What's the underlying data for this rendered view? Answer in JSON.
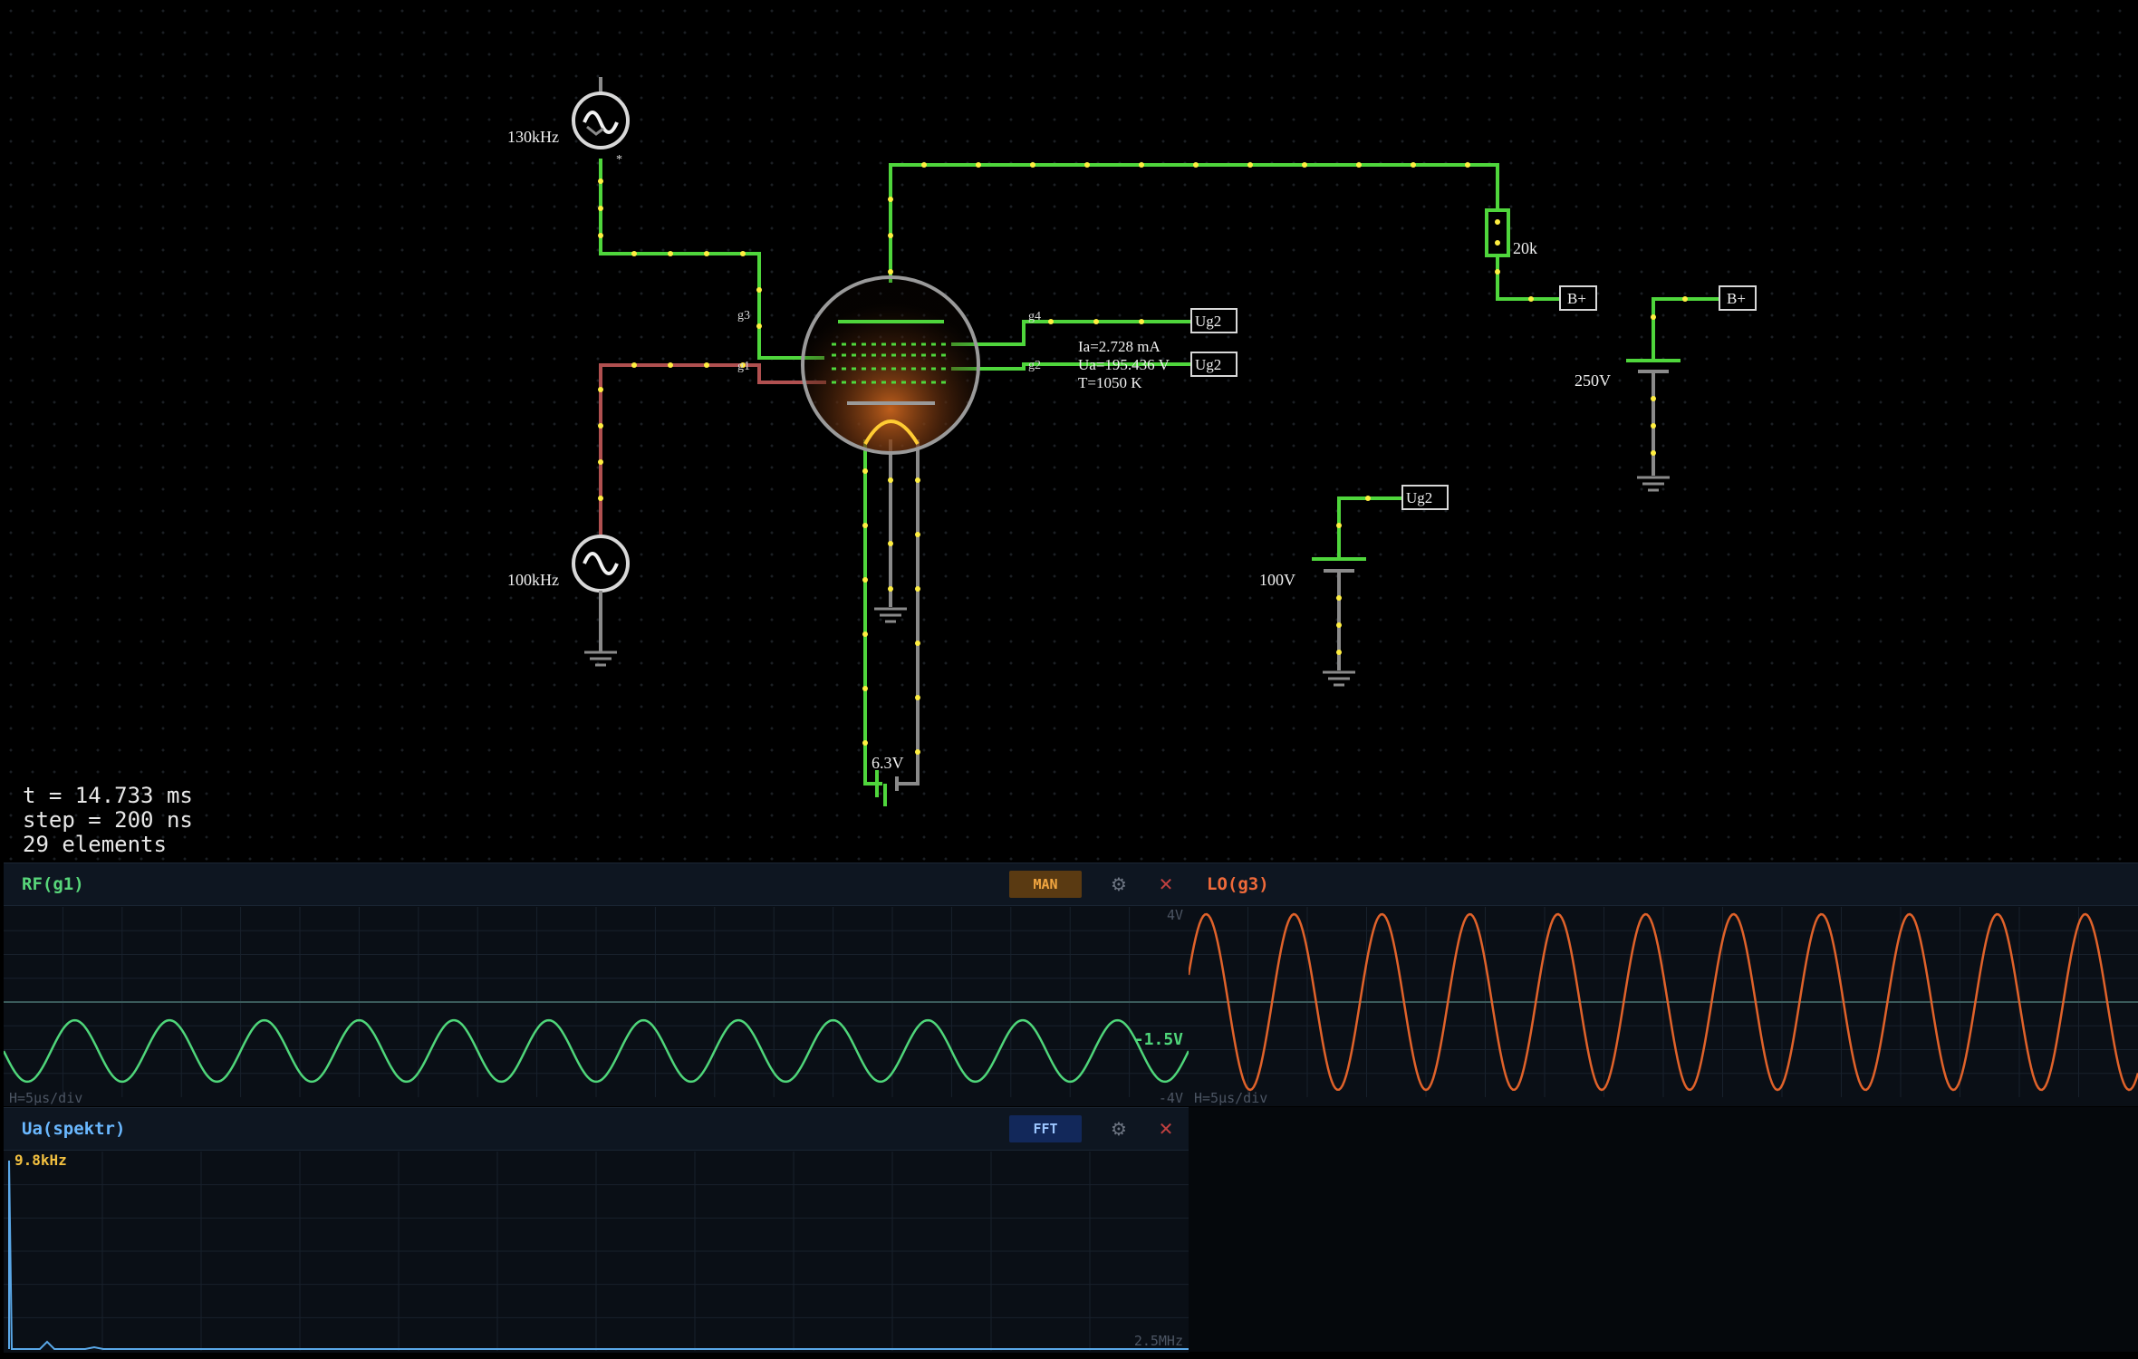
{
  "circuit": {
    "labels": {
      "src_lo_freq": "130kHz",
      "src_rf_freq": "100kHz",
      "resistor": "20k",
      "bplus_1": "B+",
      "bplus_2": "B+",
      "ug2_1": "Ug2",
      "ug2_2": "Ug2",
      "ug2_3": "Ug2",
      "bat_250": "250V",
      "bat_100": "100V",
      "heater": "6.3V",
      "g3": "g3",
      "g1": "g1",
      "g4": "g4",
      "g2": "g2",
      "tube_ia": "Ia=2.728 mA",
      "tube_ua": "Ua=195.436 V",
      "tube_t": "T=1050 K"
    },
    "colors": {
      "wire_active": "#4fd63c",
      "wire_idle": "#8a8a8a",
      "wire_neg": "#b05050",
      "current_dot": "#ffee40",
      "tube_glow": "#c8641e",
      "filament": "#ffcc33"
    }
  },
  "sim_info": {
    "time": "t = 14.733 ms",
    "step": "step = 200 ns",
    "elements": "29 elements"
  },
  "scopes": [
    {
      "title": "RF(g1)",
      "title_color": "#58d67a",
      "mode": "MAN",
      "mode_color": "#f2a640",
      "mode_bg": "#5a3a12",
      "settings_icon": "gear-icon",
      "close_icon": "close-icon",
      "y_max": "4V",
      "y_min": "-4V",
      "h_div": "H=5µs/div",
      "value": "-1.5V",
      "trace_color": "#4fd67a",
      "amplitude": 0.35,
      "cycles": 12.5
    },
    {
      "title": "LO(g3)",
      "title_color": "#f06a3a",
      "h_div": "H=5µs/div",
      "trace_color": "#e0622a",
      "amplitude": 1.0,
      "cycles": 10.8
    },
    {
      "title": "Ua(spektr)",
      "title_color": "#6ab8ff",
      "mode": "FFT",
      "mode_color": "#9cc6ff",
      "mode_bg": "#12285a",
      "settings_icon": "gear-icon",
      "close_icon": "close-icon",
      "peak": "9.8kHz",
      "x_max": "2.5MHz",
      "trace_color": "#5aa8e8"
    }
  ]
}
